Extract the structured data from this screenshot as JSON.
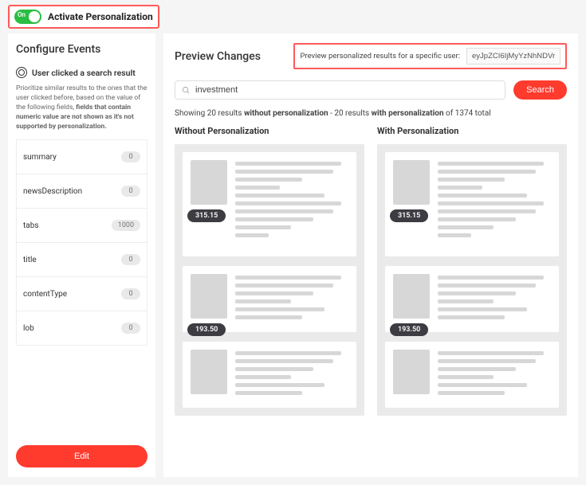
{
  "header": {
    "toggle_on": "On",
    "activate_label": "Activate Personalization"
  },
  "sidebar": {
    "title": "Configure Events",
    "event_label": "User clicked a search result",
    "priority_pre": "Prioritize similar results to the ones that the user clicked before, based on the value of the following fields, ",
    "priority_bold": "fields that contain numeric value are not shown as it's not supported by personalization.",
    "fields": [
      {
        "name": "summary",
        "value": "0"
      },
      {
        "name": "newsDescription",
        "value": "0"
      },
      {
        "name": "tabs",
        "value": "1000"
      },
      {
        "name": "title",
        "value": "0"
      },
      {
        "name": "contentType",
        "value": "0"
      },
      {
        "name": "lob",
        "value": "0"
      }
    ],
    "edit_label": "Edit"
  },
  "preview": {
    "title": "Preview Changes",
    "user_label": "Preview personalized results for a specific user:",
    "user_value": "eyJpZCI6IjMyYzNhNDVr",
    "search_value": "investment",
    "search_button": "Search",
    "summary": {
      "s1": "Showing 20 results ",
      "b1": "without personalization",
      "s2": " - 20 results ",
      "b2": "with personalization",
      "s3": " of 1374 total"
    },
    "columns": {
      "without": "Without Personalization",
      "with": "With Personalization"
    },
    "cards_without": [
      {
        "score": "315.15"
      },
      {
        "score": "193.50"
      },
      {
        "score": ""
      }
    ],
    "cards_with": [
      {
        "score": "315.15"
      },
      {
        "score": "193.50"
      },
      {
        "score": ""
      }
    ]
  }
}
